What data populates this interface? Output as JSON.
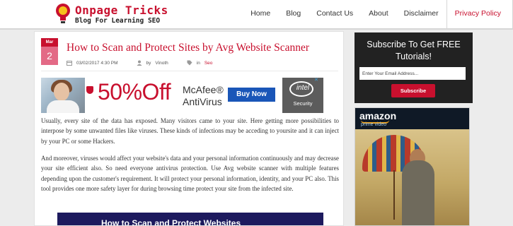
{
  "site": {
    "title": "Onpage Tricks",
    "tagline": "Blog For Learning SEO"
  },
  "nav": [
    "Home",
    "Blog",
    "Contact Us",
    "About",
    "Disclaimer",
    "Privacy Policy"
  ],
  "nav_active": "Privacy Policy",
  "post": {
    "month": "Mar",
    "day": "2",
    "title": "How to Scan and Protect Sites by Avg Website Scanner",
    "datetime": "03/02/2017 4:30 PM",
    "author_prefix": "by",
    "author": "Vinoth",
    "category_prefix": "in",
    "category": "Seo",
    "paragraphs": [
      "Usually, every site of the data has exposed. Many visitors came to your site. Here getting more possibilities to interpose by some unwanted files like viruses. These kinds of infections may be acceding to yoursite and it can inject by your PC or some Hackers.",
      "And moreover, viruses would affect your website's data and your personal information continuously and may decrease your site efficient also. So need everyone antivirus protection. Use Avg website scanner with multiple features depending upon the customer's requirement. It will protect your personal information, identity, and your PC also. This tool provides one more safety layer for during browsing time protect your site from the infected site."
    ],
    "banner_text": "How to Scan and Protect Websites"
  },
  "ad": {
    "offer": "50%Off",
    "brand_line1": "McAfee®",
    "brand_line2": "AntiVirus",
    "button": "Buy Now",
    "intel": "intel",
    "intel_sub": "Security"
  },
  "subscribe": {
    "title": "Subscribe To Get FREE Tutorials!",
    "placeholder": "Enter Your Email Address...",
    "button": "Subscribe"
  },
  "sidebar_ad": {
    "brand": "amazon",
    "sub": "prime video"
  },
  "colors": {
    "accent": "#c8102e",
    "sidebar_bg": "#222222",
    "buy_button": "#1a56b8"
  }
}
